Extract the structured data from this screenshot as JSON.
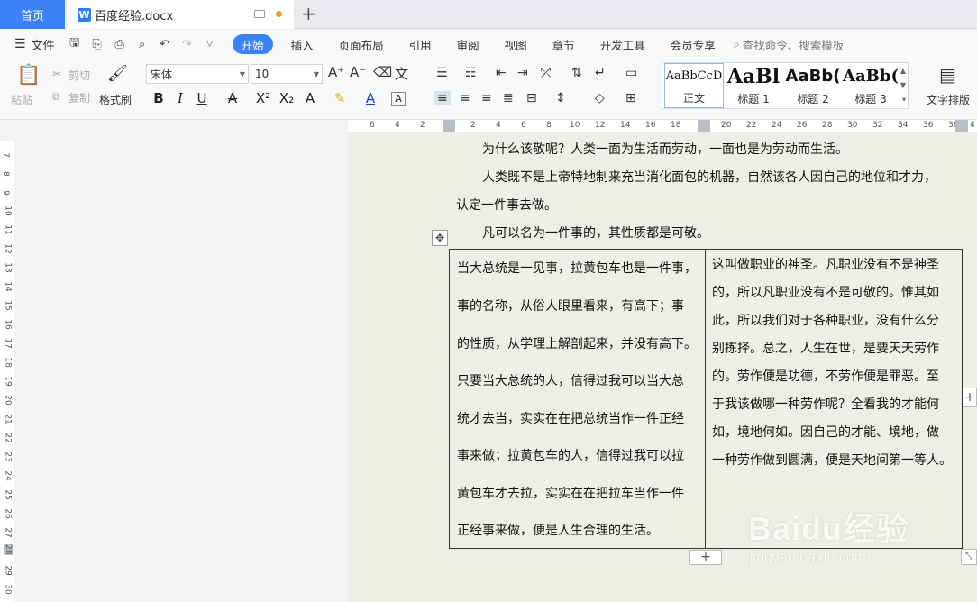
{
  "tabs": {
    "home": "首页",
    "document": "百度经验.docx"
  },
  "menu": {
    "file": "文件",
    "items": [
      "开始",
      "插入",
      "页面布局",
      "引用",
      "审阅",
      "视图",
      "章节",
      "开发工具",
      "会员专享"
    ],
    "search_placeholder": "查找命令、搜索模板"
  },
  "toolbar": {
    "paste": "粘贴",
    "cut": "剪切",
    "copy": "复制",
    "format_painter": "格式刷",
    "font_name": "宋体",
    "font_size": "10",
    "text_layout": "文字排版",
    "styles": [
      {
        "preview": "AaBbCcD",
        "label": "正文"
      },
      {
        "preview": "AaBl",
        "label": "标题 1"
      },
      {
        "preview": "AaBb(",
        "label": "标题 2"
      },
      {
        "preview": "AaBb(",
        "label": "标题 3"
      }
    ]
  },
  "ruler": {
    "h_left": [
      "6",
      "4",
      "2"
    ],
    "h_right": [
      "2",
      "4",
      "6",
      "8",
      "10",
      "12",
      "14",
      "16",
      "18",
      "20",
      "22",
      "24",
      "26",
      "28",
      "30",
      "32",
      "34",
      "36",
      "38",
      "4"
    ],
    "v": [
      "7",
      "8",
      "9",
      "10",
      "11",
      "12",
      "13",
      "14",
      "15",
      "16",
      "17",
      "18",
      "19",
      "20",
      "21",
      "22",
      "23",
      "24",
      "25",
      "26",
      "27",
      "28",
      "29",
      "30"
    ]
  },
  "document": {
    "lines": [
      "为什么该敬呢？人类一面为生活而劳动，一面也是为劳动而生活。",
      "人类既不是上帝特地制来充当消化面包的机器，自然该各人因自己的地位和才力，",
      "认定一件事去做。",
      "凡可以名为一件事的，其性质都是可敬。"
    ],
    "table": {
      "col1": [
        "当大总统是一见事，拉黄包车也是一件事，",
        "事的名称，从俗人眼里看来，有高下；事",
        "的性质，从学理上解剖起来，并没有高下。",
        "只要当大总统的人，信得过我可以当大总",
        "统才去当，实实在在把总统当作一件正经",
        "事来做；拉黄包车的人，信得过我可以拉",
        "黄包车才去拉，实实在在把拉车当作一件",
        "正经事来做，便是人生合理的生活。"
      ],
      "col2": [
        "这叫做职业的神圣。凡职业没有不是神圣",
        "的，所以凡职业没有不是可敬的。惟其如",
        "此，所以我们对于各种职业，没有什么分",
        "别拣择。总之，人生在世，是要天天劳作",
        "的。劳作便是功德，不劳作便是罪恶。至",
        "于我该做哪一种劳作呢？全看我的才能何",
        "如，境地何如。因自己的才能、境地，做",
        "一种劳作做到圆满，便是天地间第一等人。"
      ]
    }
  },
  "watermark": {
    "main": "Baidu经验",
    "sub": "jingyan.baidu.com"
  },
  "colors": {
    "accent": "#3c82f6",
    "page_bg": "#efeee6"
  }
}
